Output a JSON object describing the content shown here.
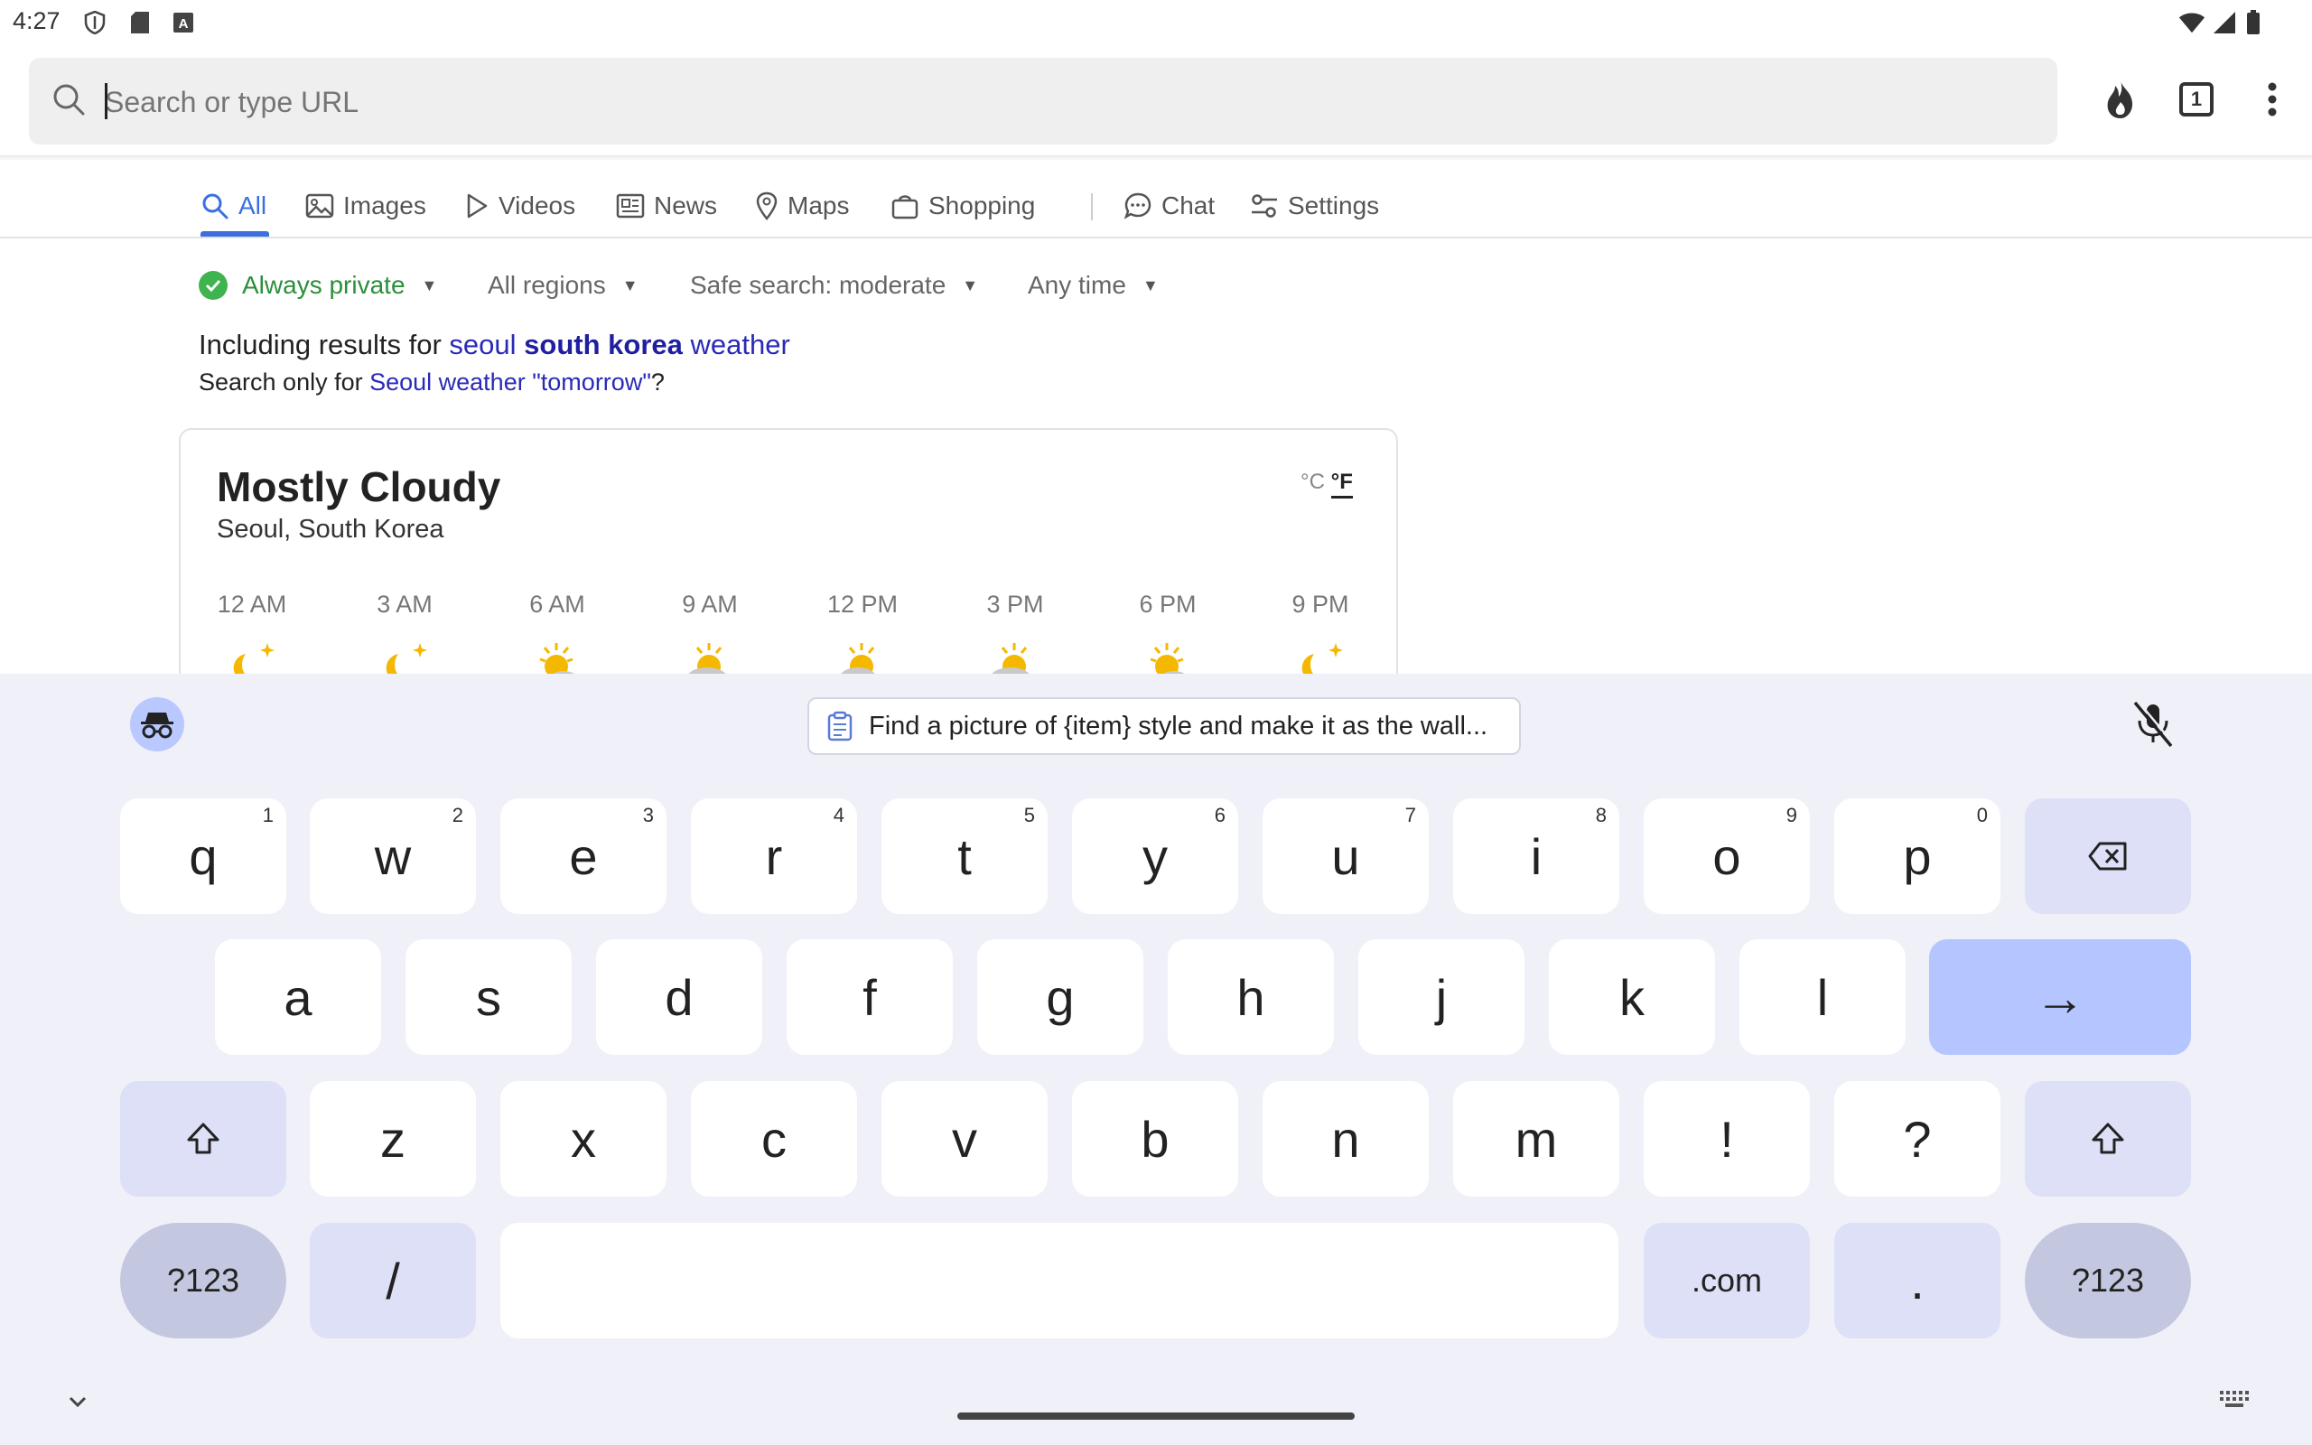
{
  "status_bar": {
    "time": "4:27"
  },
  "url_bar": {
    "placeholder": "Search or type URL",
    "tab_count": "1"
  },
  "tabs": [
    {
      "label": "All",
      "icon": "search-icon"
    },
    {
      "label": "Images",
      "icon": "image-icon"
    },
    {
      "label": "Videos",
      "icon": "play-icon"
    },
    {
      "label": "News",
      "icon": "newspaper-icon"
    },
    {
      "label": "Maps",
      "icon": "map-pin-icon"
    },
    {
      "label": "Shopping",
      "icon": "shopping-bag-icon"
    },
    {
      "label": "Chat",
      "icon": "chat-icon"
    },
    {
      "label": "Settings",
      "icon": "sliders-icon"
    }
  ],
  "filters": {
    "privacy": "Always private",
    "region": "All regions",
    "safe_search": "Safe search: moderate",
    "time": "Any time"
  },
  "results": {
    "including_prefix": "Including results for ",
    "including_q1": "seoul ",
    "including_q2": "south korea",
    "including_q3": " weather",
    "search_only_prefix": "Search only for ",
    "search_only_link": "Seoul weather \"tomorrow\"",
    "search_only_suffix": "?"
  },
  "weather": {
    "condition": "Mostly Cloudy",
    "location": "Seoul, South Korea",
    "unit_c": "°C",
    "unit_f": "°F",
    "hours": [
      {
        "time": "12 AM",
        "icon": "moon-star-icon"
      },
      {
        "time": "3 AM",
        "icon": "moon-star-icon"
      },
      {
        "time": "6 AM",
        "icon": "sun-cloud-icon"
      },
      {
        "time": "9 AM",
        "icon": "sun-cloud-icon"
      },
      {
        "time": "12 PM",
        "icon": "sun-cloud-icon"
      },
      {
        "time": "3 PM",
        "icon": "sun-cloud-icon"
      },
      {
        "time": "6 PM",
        "icon": "sun-cloud-icon"
      },
      {
        "time": "9 PM",
        "icon": "moon-star-icon"
      }
    ]
  },
  "keyboard": {
    "suggestion": "Find a picture of {item} style and make it as the wall...",
    "row1": [
      {
        "k": "q",
        "h": "1"
      },
      {
        "k": "w",
        "h": "2"
      },
      {
        "k": "e",
        "h": "3"
      },
      {
        "k": "r",
        "h": "4"
      },
      {
        "k": "t",
        "h": "5"
      },
      {
        "k": "y",
        "h": "6"
      },
      {
        "k": "u",
        "h": "7"
      },
      {
        "k": "i",
        "h": "8"
      },
      {
        "k": "o",
        "h": "9"
      },
      {
        "k": "p",
        "h": "0"
      }
    ],
    "row2": [
      "a",
      "s",
      "d",
      "f",
      "g",
      "h",
      "j",
      "k",
      "l"
    ],
    "row3": [
      "z",
      "x",
      "c",
      "v",
      "b",
      "n",
      "m",
      "!",
      "?"
    ],
    "enter": "→",
    "sym_left": "?123",
    "slash": "/",
    "dotcom": ".com",
    "period": ".",
    "sym_right": "?123"
  }
}
